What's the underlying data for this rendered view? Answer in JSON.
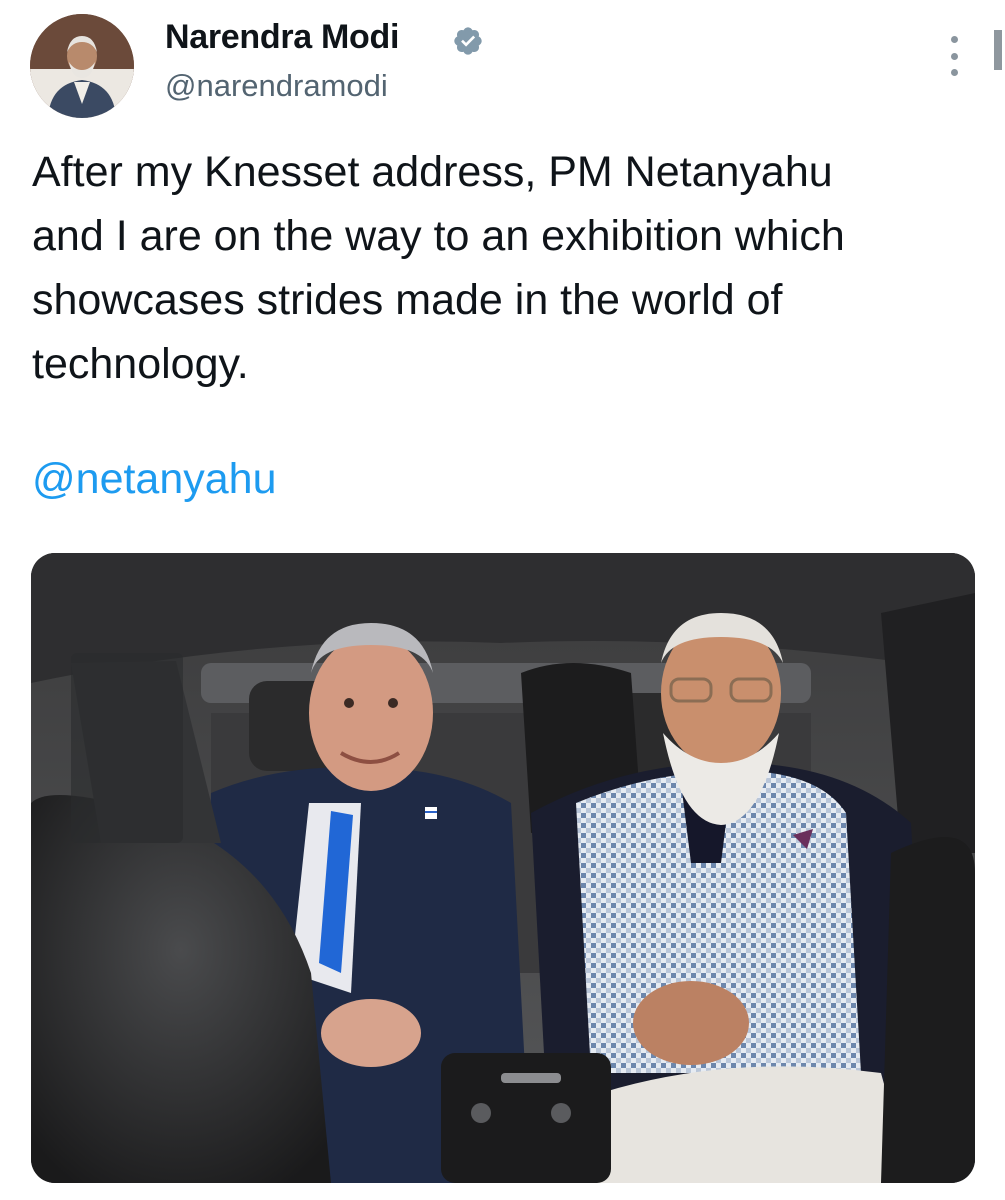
{
  "author": {
    "display_name": "Narendra Modi",
    "handle": "@narendramodi",
    "verified": true,
    "verified_badge_color": "#829aab"
  },
  "tweet": {
    "text": "After my Knesset address, PM Netanyahu\nand I are on the way to an exhibition which\nshowcases strides made in the world of\ntechnology.",
    "mention": "@netanyahu",
    "mention_color": "#1d9bf0"
  },
  "media": {
    "type": "photo",
    "flag_pin": "Israel flag lapel pin"
  },
  "icons": {
    "verified": "verified-badge-icon",
    "more": "more-vertical-icon"
  }
}
